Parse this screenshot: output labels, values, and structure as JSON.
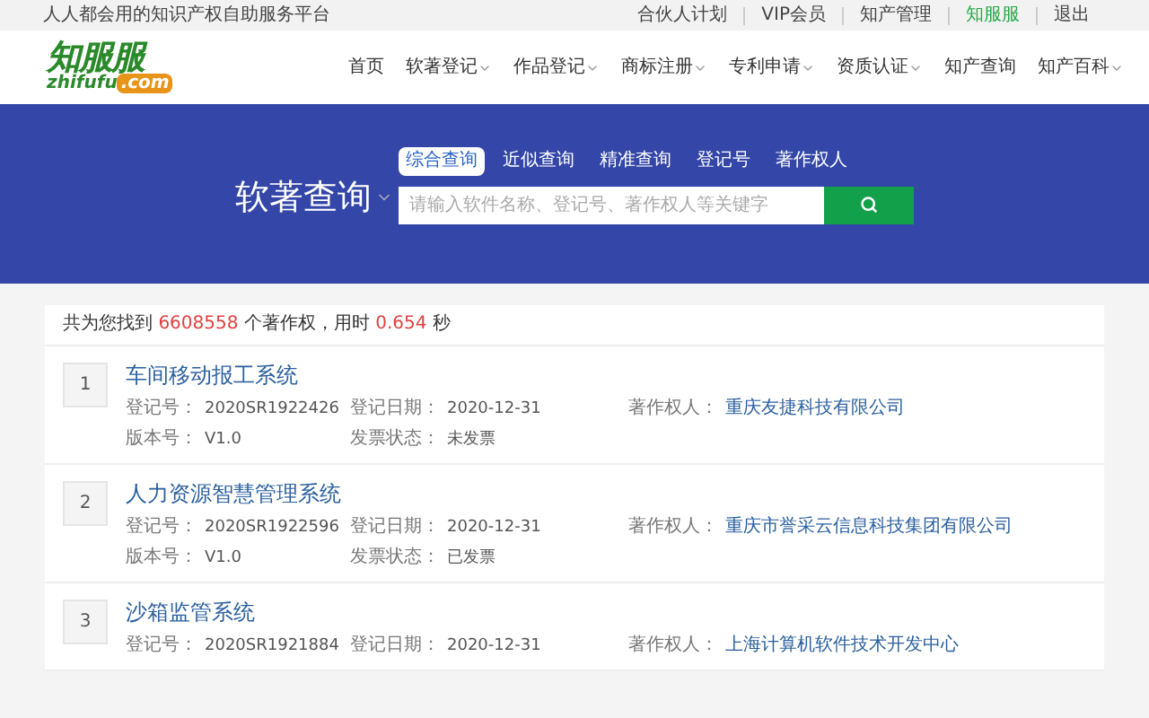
{
  "top_bar": {
    "slogan": "人人都会用的知识产权自助服务平台",
    "links": [
      {
        "label": "合伙人计划",
        "highlighted": false
      },
      {
        "label": "VIP会员",
        "highlighted": false
      },
      {
        "label": "知产管理",
        "highlighted": false
      },
      {
        "label": "知服服",
        "highlighted": true
      },
      {
        "label": "退出",
        "highlighted": false
      }
    ]
  },
  "logo": {
    "name": "知服服",
    "domain": "zhifufu",
    "domain_suffix": ".com"
  },
  "nav": [
    {
      "label": "首页",
      "has_menu": false
    },
    {
      "label": "软著登记",
      "has_menu": true
    },
    {
      "label": "作品登记",
      "has_menu": true
    },
    {
      "label": "商标注册",
      "has_menu": true
    },
    {
      "label": "专利申请",
      "has_menu": true
    },
    {
      "label": "资质认证",
      "has_menu": true
    },
    {
      "label": "知产查询",
      "has_menu": false
    },
    {
      "label": "知产百科",
      "has_menu": true
    }
  ],
  "search": {
    "title": "软著查询",
    "tabs": [
      {
        "label": "综合查询",
        "selected": true
      },
      {
        "label": "近似查询",
        "selected": false
      },
      {
        "label": "精准查询",
        "selected": false
      },
      {
        "label": "登记号",
        "selected": false
      },
      {
        "label": "著作权人",
        "selected": false
      }
    ],
    "placeholder": "请输入软件名称、登记号、著作权人等关键字"
  },
  "summary": {
    "prefix": "共为您找到",
    "count": "6608558",
    "middle": "个著作权，用时",
    "time": "0.654",
    "suffix": "秒"
  },
  "results": [
    {
      "index": "1",
      "title": "车间移动报工系统",
      "fields": [
        {
          "label": "登记号：",
          "value": "2020SR1922426",
          "link": false
        },
        {
          "label": "登记日期：",
          "value": "2020-12-31",
          "link": false
        },
        {
          "label": "著作权人：",
          "value": "重庆友捷科技有限公司",
          "link": true
        },
        {
          "label": "版本号：",
          "value": "V1.0",
          "link": false
        },
        {
          "label": "发票状态：",
          "value": "未发票",
          "link": false
        }
      ]
    },
    {
      "index": "2",
      "title": "人力资源智慧管理系统",
      "fields": [
        {
          "label": "登记号：",
          "value": "2020SR1922596",
          "link": false
        },
        {
          "label": "登记日期：",
          "value": "2020-12-31",
          "link": false
        },
        {
          "label": "著作权人：",
          "value": "重庆市誉采云信息科技集团有限公司",
          "link": true
        },
        {
          "label": "版本号：",
          "value": "V1.0",
          "link": false
        },
        {
          "label": "发票状态：",
          "value": "已发票",
          "link": false
        }
      ]
    },
    {
      "index": "3",
      "title": "沙箱监管系统",
      "fields": [
        {
          "label": "登记号：",
          "value": "2020SR1921884",
          "link": false
        },
        {
          "label": "登记日期：",
          "value": "2020-12-31",
          "link": false
        },
        {
          "label": "著作权人：",
          "value": "上海计算机软件技术开发中心",
          "link": true
        }
      ]
    }
  ]
}
